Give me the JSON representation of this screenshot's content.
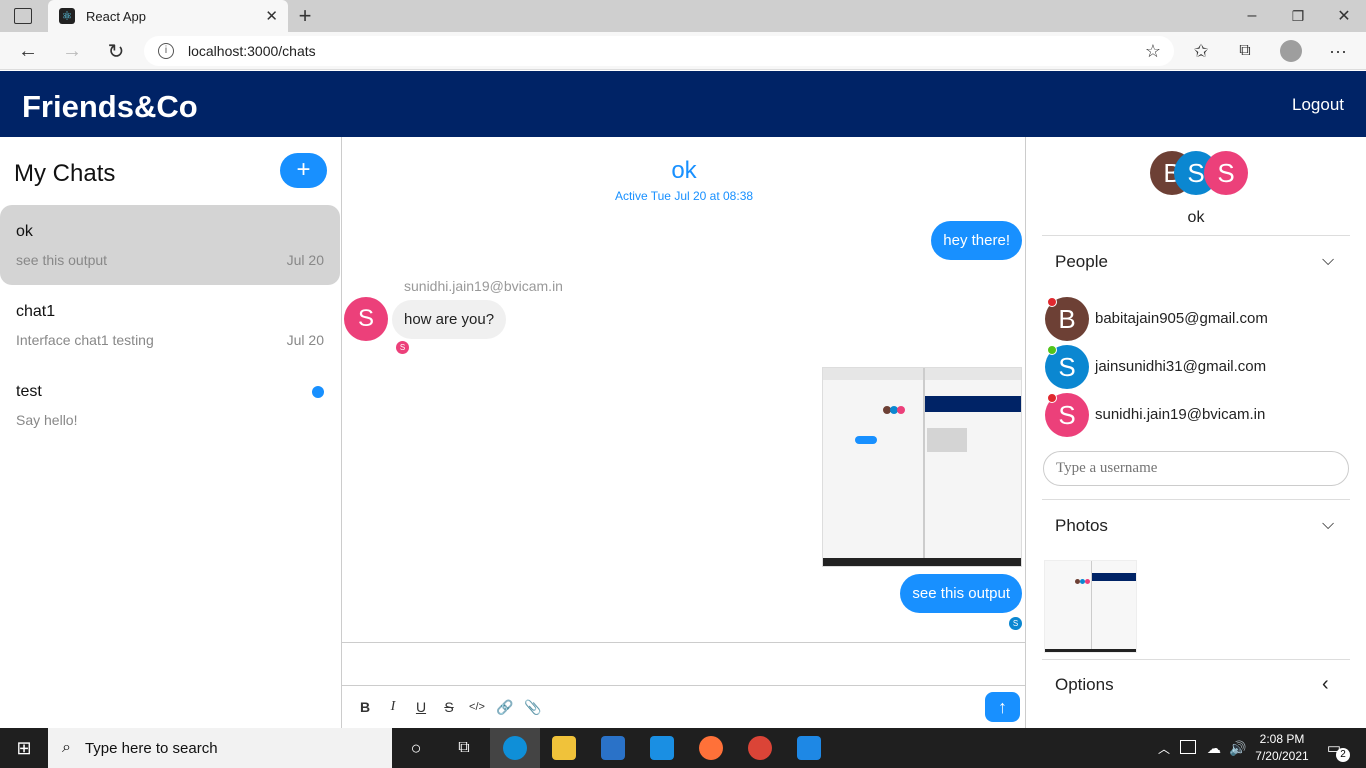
{
  "browser": {
    "tab_title": "React App",
    "url": "localhost:3000/chats"
  },
  "app": {
    "logo": "Friends&Co",
    "logout": "Logout"
  },
  "chat_list": {
    "heading": "My Chats",
    "new_chat_symbol": "+",
    "items": [
      {
        "title": "ok",
        "preview": "see this output",
        "date": "Jul 20",
        "selected": true
      },
      {
        "title": "chat1",
        "preview": "Interface chat1 testing",
        "date": "Jul 20",
        "selected": false
      },
      {
        "title": "test",
        "preview": "Say hello!",
        "date": "",
        "unread": true
      }
    ]
  },
  "chat": {
    "title": "ok",
    "subtitle": "Active Tue Jul 20 at 08:38",
    "messages": [
      {
        "text": "hey there!",
        "mine": true
      },
      {
        "sender": "sunidhi.jain19@bvicam.in",
        "avatar": "S",
        "text": "how are you?",
        "mine": false
      },
      {
        "image": "screenshot",
        "mine": true
      },
      {
        "text": "see this output",
        "mine": true
      }
    ],
    "read_receipt": "S"
  },
  "details": {
    "avatars": [
      "B",
      "S",
      "S"
    ],
    "chat_name": "ok",
    "people_label": "People",
    "people": [
      {
        "initial": "B",
        "email": "babitajain905@gmail.com",
        "color": "#6d4035",
        "status": "#e0282e"
      },
      {
        "initial": "S",
        "email": "jainsunidhi31@gmail.com",
        "color": "#0b87d1",
        "status": "#52c41a"
      },
      {
        "initial": "S",
        "email": "sunidhi.jain19@bvicam.in",
        "color": "#ec407a",
        "status": "#e0282e"
      }
    ],
    "username_placeholder": "Type a username",
    "photos_label": "Photos",
    "options_label": "Options"
  },
  "taskbar": {
    "search_placeholder": "Type here to search",
    "time": "2:08 PM",
    "date": "7/20/2021",
    "notification_count": "2"
  },
  "colors": {
    "brand": "#002366",
    "accent": "#1890ff"
  }
}
